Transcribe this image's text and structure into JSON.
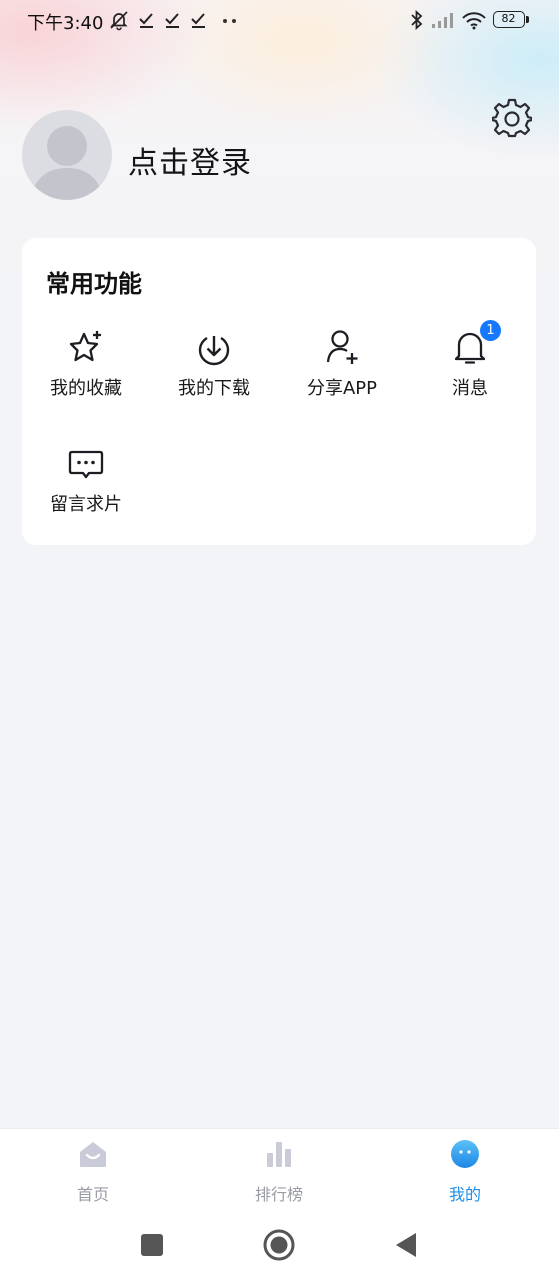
{
  "status_bar": {
    "time": "下午3:40",
    "battery": "82",
    "icons": [
      "mute-icon",
      "check-icon",
      "check-icon",
      "check-icon",
      "more-dots-icon",
      "bluetooth-icon",
      "signal-icon",
      "wifi-icon",
      "battery-icon"
    ]
  },
  "profile": {
    "login_label": "点击登录",
    "avatar_icon": "avatar-placeholder-icon",
    "settings_icon": "gear-icon"
  },
  "functions": {
    "title": "常用功能",
    "items": [
      {
        "label": "我的收藏",
        "icon": "star-plus-icon"
      },
      {
        "label": "我的下载",
        "icon": "download-icon"
      },
      {
        "label": "分享APP",
        "icon": "user-plus-icon"
      },
      {
        "label": "消息",
        "icon": "bell-icon",
        "badge": "1"
      },
      {
        "label": "留言求片",
        "icon": "chat-bubble-icon"
      }
    ]
  },
  "tab_bar": {
    "tabs": [
      {
        "label": "首页",
        "icon": "home-icon",
        "active": false
      },
      {
        "label": "排行榜",
        "icon": "bar-chart-icon",
        "active": false
      },
      {
        "label": "我的",
        "icon": "face-icon",
        "active": true
      }
    ]
  },
  "colors": {
    "accent": "#1f8ee8",
    "badge": "#1677ff",
    "background": "#f3f4f7",
    "card": "#ffffff"
  }
}
